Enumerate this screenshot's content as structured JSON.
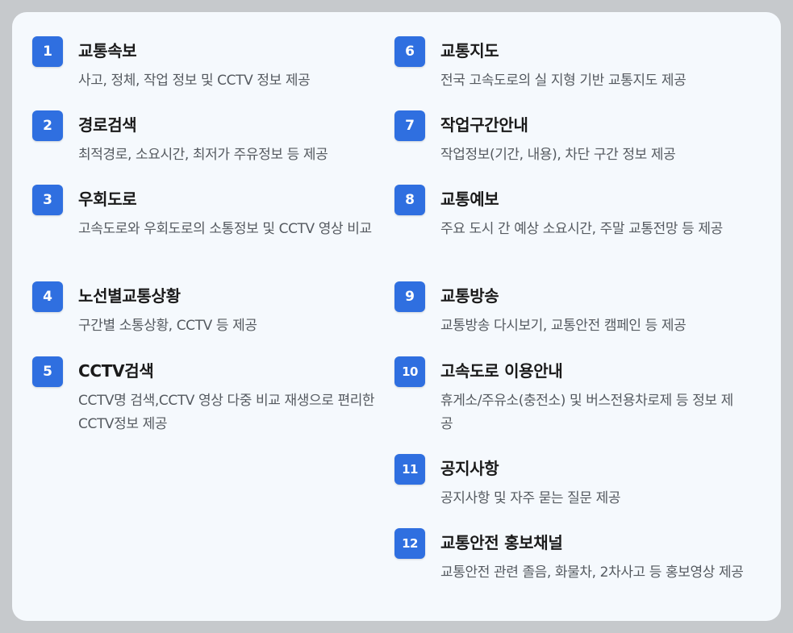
{
  "items": [
    {
      "num": "1",
      "title": "교통속보",
      "desc": "사고, 정체, 작업 정보 및 CCTV 정보 제공"
    },
    {
      "num": "2",
      "title": "경로검색",
      "desc": "최적경로, 소요시간, 최저가 주유정보 등 제공"
    },
    {
      "num": "3",
      "title": "우회도로",
      "desc": "고속도로와 우회도로의 소통정보 및 CCTV 영상 비교"
    },
    {
      "num": "4",
      "title": "노선별교통상황",
      "desc": "구간별 소통상황, CCTV 등 제공"
    },
    {
      "num": "5",
      "title": "CCTV검색",
      "desc": "CCTV명 검색,CCTV 영상 다중 비교 재생으로 편리한 CCTV정보 제공"
    },
    {
      "num": "6",
      "title": "교통지도",
      "desc": "전국 고속도로의 실 지형 기반 교통지도 제공"
    },
    {
      "num": "7",
      "title": "작업구간안내",
      "desc": "작업정보(기간, 내용), 차단 구간 정보 제공"
    },
    {
      "num": "8",
      "title": "교통예보",
      "desc": "주요 도시 간 예상 소요시간, 주말 교통전망 등 제공"
    },
    {
      "num": "9",
      "title": "교통방송",
      "desc": "교통방송 다시보기, 교통안전 캠페인 등 제공"
    },
    {
      "num": "10",
      "title": "고속도로 이용안내",
      "desc": "휴게소/주유소(충전소) 및 버스전용차로제 등 정보 제공"
    },
    {
      "num": "11",
      "title": "공지사항",
      "desc": "공지사항 및 자주 묻는 질문 제공"
    },
    {
      "num": "12",
      "title": "교통안전 홍보채널",
      "desc": "교통안전 관련 졸음, 화물차, 2차사고 등 홍보영상 제공"
    }
  ]
}
